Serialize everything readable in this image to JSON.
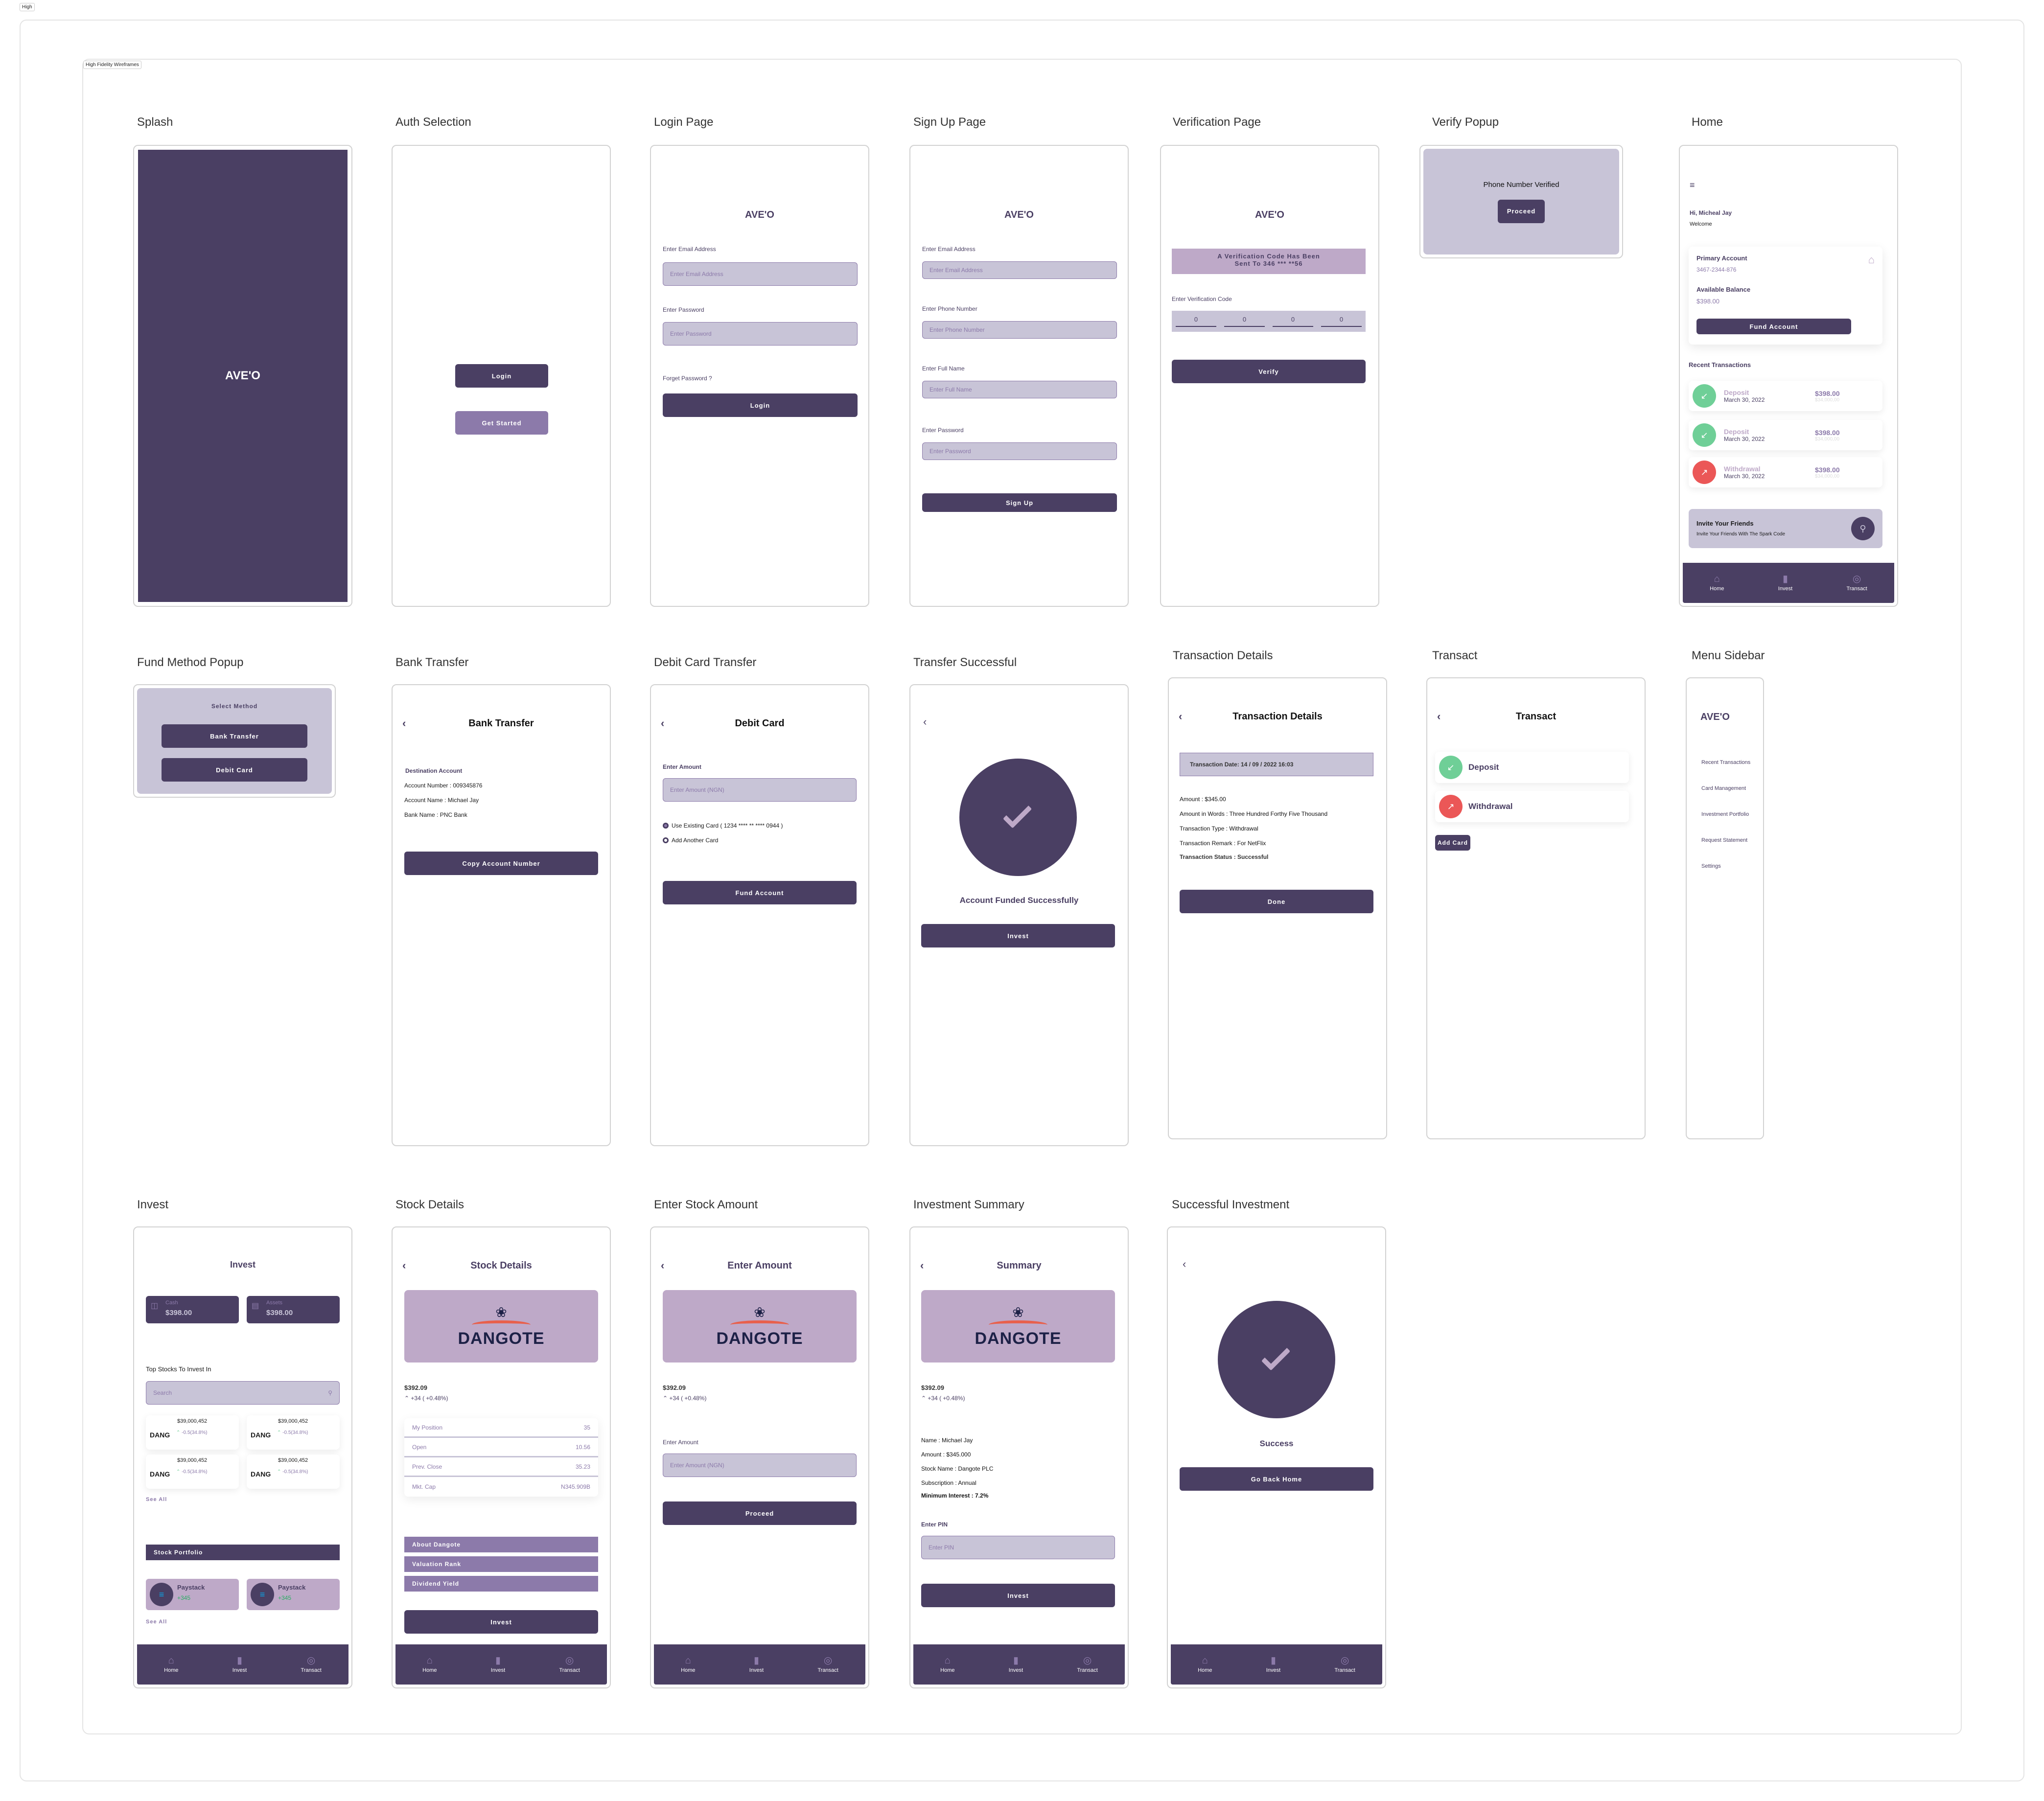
{
  "canvas": {
    "page_tag": "High",
    "section_tag": "High Fidelity Wireframes"
  },
  "brand": {
    "name": "AVE'O",
    "primary": "#4a3f63",
    "light": "#c8c4d7",
    "accent": "#8c7aaa",
    "mauve": "#bea9c8",
    "green": "#6fcf97",
    "red": "#eb5757"
  },
  "nav": {
    "items": [
      {
        "label": "Home",
        "icon": "home-icon"
      },
      {
        "label": "Invest",
        "icon": "bar-chart-icon"
      },
      {
        "label": "Transact",
        "icon": "target-icon"
      }
    ]
  },
  "splash": {
    "label": "Splash",
    "logo": "AVE'O"
  },
  "auth": {
    "label": "Auth Selection",
    "login": "Login",
    "get_started": "Get Started"
  },
  "login": {
    "label": "Login Page",
    "logo": "AVE'O",
    "email_label": "Enter Email Address",
    "email_placeholder": "Enter Email Address",
    "password_label": "Enter Password",
    "password_placeholder": "Enter Password",
    "forgot": "Forget Password ?",
    "button": "Login"
  },
  "signup": {
    "label": "Sign Up Page",
    "logo": "AVE'O",
    "fields": [
      {
        "label": "Enter Email Address",
        "placeholder": "Enter Email Address"
      },
      {
        "label": "Enter Phone Number",
        "placeholder": "Enter Phone Number"
      },
      {
        "label": "Enter Full Name",
        "placeholder": "Enter Full Name"
      },
      {
        "label": "Enter Password",
        "placeholder": "Enter Password"
      }
    ],
    "button": "Sign Up"
  },
  "verification": {
    "label": "Verification Page",
    "logo": "AVE'O",
    "banner_line1": "A Verification Code Has Been",
    "banner_line2": "Sent To 346 *** **56",
    "code_label": "Enter Verification Code",
    "digits": [
      "0",
      "0",
      "0",
      "0"
    ],
    "button": "Verify"
  },
  "verify_popup": {
    "label": "Verify Popup",
    "message": "Phone Number Verified",
    "button": "Proceed"
  },
  "home": {
    "label": "Home",
    "greeting": "Hi, Micheal Jay",
    "welcome": "Welcome",
    "account": {
      "title": "Primary Account",
      "number": "3467-2344-876",
      "balance_label": "Available Balance",
      "balance": "$398.00",
      "button": "Fund Account"
    },
    "recent_title": "Recent Transactions",
    "transactions": [
      {
        "type": "Deposit",
        "date": "March 30, 2022",
        "amount": "$398.00",
        "sub": "$34,000,00",
        "kind": "in"
      },
      {
        "type": "Deposit",
        "date": "March 30, 2022",
        "amount": "$398.00",
        "sub": "$34,000,00",
        "kind": "in"
      },
      {
        "type": "Withdrawal",
        "date": "March 30, 2022",
        "amount": "$398.00",
        "sub": "$34,000,00",
        "kind": "out"
      }
    ],
    "invite_title": "Invite Your Friends",
    "invite_sub": "Invite Your Friends With The Spark Code"
  },
  "fund_popup": {
    "label": "Fund Method Popup",
    "title": "Select Method",
    "options": [
      "Bank Transfer",
      "Debit Card"
    ]
  },
  "bank_transfer": {
    "label": "Bank Transfer",
    "title": "Bank Transfer",
    "section": "Destination Account",
    "account_number": "Account Number : 009345876",
    "account_name": "Account Name : Michael Jay",
    "bank_name": "Bank Name : PNC Bank",
    "button": "Copy Account Number"
  },
  "debit_card": {
    "label": "Debit Card Transfer",
    "title": "Debit Card",
    "amount_label": "Enter Amount",
    "amount_placeholder": "Enter Amount (NGN)",
    "options": [
      "Use Existing Card ( 1234 **** ** **** 0944 )",
      "Add Another Card"
    ],
    "button": "Fund Account"
  },
  "transfer_success": {
    "label": "Transfer Successful",
    "message": "Account Funded Successfully",
    "button": "Invest"
  },
  "tx_details": {
    "label": "Transaction Details",
    "title": "Transaction Details",
    "date": "Transaction Date: 14 / 09 / 2022 16:03",
    "lines": [
      "Amount : $345.00",
      "Amount in Words : Three Hundred Forthy Five Thousand",
      "Transaction Type : Withdrawal",
      "Transaction Remark : For NetFlix"
    ],
    "status": "Transaction Status : Successful",
    "button": "Done"
  },
  "transact": {
    "label": "Transact",
    "title": "Transact",
    "deposit": "Deposit",
    "withdrawal": "Withdrawal",
    "add_card": "Add Card"
  },
  "menu": {
    "label": "Menu Sidebar",
    "logo": "AVE'O",
    "items": [
      "Recent Transactions",
      "Card Management",
      "Investment Portfolio",
      "Request Statement",
      "Settings"
    ]
  },
  "invest": {
    "label": "Invest",
    "title": "Invest",
    "cash_label": "Cash",
    "cash": "$398.00",
    "assets_label": "Assets",
    "assets": "$398.00",
    "top_title": "Top Stocks To Invest In",
    "search_placeholder": "Search",
    "stocks": [
      {
        "ticker": "DANG",
        "price": "$39,000,452",
        "change": "-0.5(34.8%)"
      },
      {
        "ticker": "DANG",
        "price": "$39,000,452",
        "change": "-0.5(34.8%)"
      },
      {
        "ticker": "DANG",
        "price": "$39,000,452",
        "change": "-0.5(34.8%)"
      },
      {
        "ticker": "DANG",
        "price": "$39,000,452",
        "change": "-0.5(34.8%)"
      }
    ],
    "see_all": "See All",
    "portfolio_title": "Stock Portfolio",
    "portfolio": [
      {
        "name": "Paystack",
        "gain": "+345"
      },
      {
        "name": "Paystack",
        "gain": "+345"
      }
    ]
  },
  "stock_details": {
    "label": "Stock Details",
    "title": "Stock Details",
    "brand": "DANGOTE",
    "price": "$392.09",
    "change": "+34 ( +0.48%)",
    "stats": [
      {
        "k": "My Position",
        "v": "35"
      },
      {
        "k": "Open",
        "v": "10.56"
      },
      {
        "k": "Prev. Close",
        "v": "35.23"
      },
      {
        "k": "Mkt. Cap",
        "v": "N345.909B"
      }
    ],
    "sections": [
      "About Dangote",
      "Valuation Rank",
      "Dividend Yield"
    ],
    "button": "Invest"
  },
  "enter_amount": {
    "label": "Enter Stock Amount",
    "title": "Enter Amount",
    "brand": "DANGOTE",
    "price": "$392.09",
    "change": "+34 ( +0.48%)",
    "amount_label": "Enter Amount",
    "amount_placeholder": "Enter Amount (NGN)",
    "button": "Proceed"
  },
  "summary": {
    "label": "Investment Summary",
    "title": "Summary",
    "brand": "DANGOTE",
    "price": "$392.09",
    "change": "+34 ( +0.48%)",
    "lines": [
      "Name : Michael Jay",
      "Amount : $345.000",
      "Stock Name : Dangote PLC",
      "Subscription : Annual"
    ],
    "min_interest": "Minimum Interest : 7.2%",
    "pin_label": "Enter PIN",
    "pin_placeholder": "Enter PIN",
    "button": "Invest"
  },
  "invest_success": {
    "label": "Successful Investment",
    "message": "Success",
    "button": "Go Back Home"
  }
}
